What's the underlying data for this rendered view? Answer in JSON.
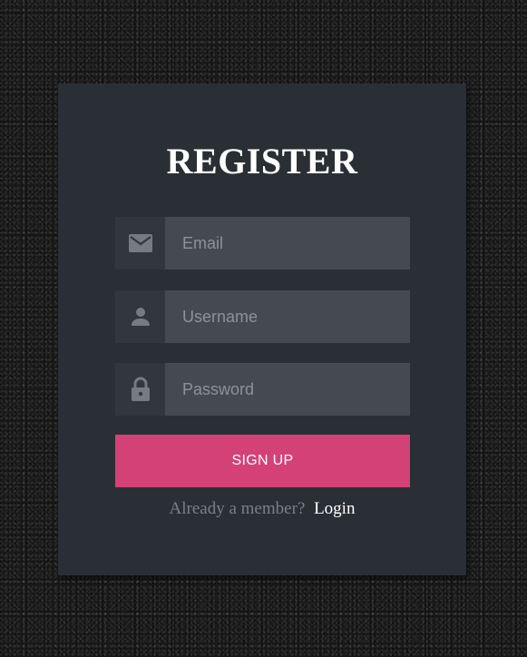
{
  "form": {
    "title": "REGISTER",
    "email": {
      "placeholder": "Email",
      "value": "",
      "icon": "envelope-icon"
    },
    "username": {
      "placeholder": "Username",
      "value": "",
      "icon": "user-icon"
    },
    "password": {
      "placeholder": "Password",
      "value": "",
      "icon": "lock-icon"
    },
    "submit_label": "SIGN UP",
    "footer_text": "Already a member?",
    "login_link": "Login"
  },
  "colors": {
    "card": "#2a2f35",
    "icon_cell": "#32373d",
    "input": "#454a50",
    "accent": "#d44177",
    "icon": "#767b81",
    "muted_text": "#7b8086"
  }
}
